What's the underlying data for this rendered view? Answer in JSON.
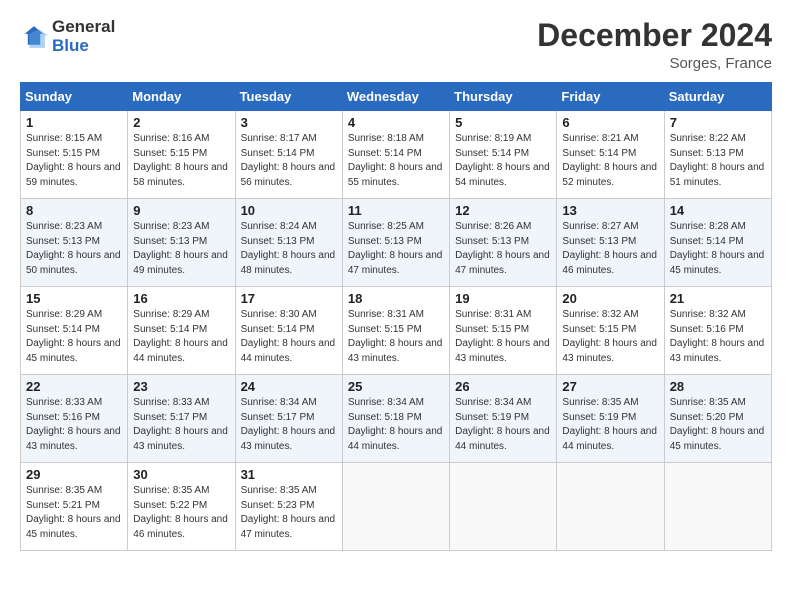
{
  "header": {
    "logo_line1": "General",
    "logo_line2": "Blue",
    "month": "December 2024",
    "location": "Sorges, France"
  },
  "days_of_week": [
    "Sunday",
    "Monday",
    "Tuesday",
    "Wednesday",
    "Thursday",
    "Friday",
    "Saturday"
  ],
  "weeks": [
    [
      {
        "day": "1",
        "sunrise": "8:15 AM",
        "sunset": "5:15 PM",
        "daylight": "8 hours and 59 minutes."
      },
      {
        "day": "2",
        "sunrise": "8:16 AM",
        "sunset": "5:15 PM",
        "daylight": "8 hours and 58 minutes."
      },
      {
        "day": "3",
        "sunrise": "8:17 AM",
        "sunset": "5:14 PM",
        "daylight": "8 hours and 56 minutes."
      },
      {
        "day": "4",
        "sunrise": "8:18 AM",
        "sunset": "5:14 PM",
        "daylight": "8 hours and 55 minutes."
      },
      {
        "day": "5",
        "sunrise": "8:19 AM",
        "sunset": "5:14 PM",
        "daylight": "8 hours and 54 minutes."
      },
      {
        "day": "6",
        "sunrise": "8:21 AM",
        "sunset": "5:14 PM",
        "daylight": "8 hours and 52 minutes."
      },
      {
        "day": "7",
        "sunrise": "8:22 AM",
        "sunset": "5:13 PM",
        "daylight": "8 hours and 51 minutes."
      }
    ],
    [
      {
        "day": "8",
        "sunrise": "8:23 AM",
        "sunset": "5:13 PM",
        "daylight": "8 hours and 50 minutes."
      },
      {
        "day": "9",
        "sunrise": "8:23 AM",
        "sunset": "5:13 PM",
        "daylight": "8 hours and 49 minutes."
      },
      {
        "day": "10",
        "sunrise": "8:24 AM",
        "sunset": "5:13 PM",
        "daylight": "8 hours and 48 minutes."
      },
      {
        "day": "11",
        "sunrise": "8:25 AM",
        "sunset": "5:13 PM",
        "daylight": "8 hours and 47 minutes."
      },
      {
        "day": "12",
        "sunrise": "8:26 AM",
        "sunset": "5:13 PM",
        "daylight": "8 hours and 47 minutes."
      },
      {
        "day": "13",
        "sunrise": "8:27 AM",
        "sunset": "5:13 PM",
        "daylight": "8 hours and 46 minutes."
      },
      {
        "day": "14",
        "sunrise": "8:28 AM",
        "sunset": "5:14 PM",
        "daylight": "8 hours and 45 minutes."
      }
    ],
    [
      {
        "day": "15",
        "sunrise": "8:29 AM",
        "sunset": "5:14 PM",
        "daylight": "8 hours and 45 minutes."
      },
      {
        "day": "16",
        "sunrise": "8:29 AM",
        "sunset": "5:14 PM",
        "daylight": "8 hours and 44 minutes."
      },
      {
        "day": "17",
        "sunrise": "8:30 AM",
        "sunset": "5:14 PM",
        "daylight": "8 hours and 44 minutes."
      },
      {
        "day": "18",
        "sunrise": "8:31 AM",
        "sunset": "5:15 PM",
        "daylight": "8 hours and 43 minutes."
      },
      {
        "day": "19",
        "sunrise": "8:31 AM",
        "sunset": "5:15 PM",
        "daylight": "8 hours and 43 minutes."
      },
      {
        "day": "20",
        "sunrise": "8:32 AM",
        "sunset": "5:15 PM",
        "daylight": "8 hours and 43 minutes."
      },
      {
        "day": "21",
        "sunrise": "8:32 AM",
        "sunset": "5:16 PM",
        "daylight": "8 hours and 43 minutes."
      }
    ],
    [
      {
        "day": "22",
        "sunrise": "8:33 AM",
        "sunset": "5:16 PM",
        "daylight": "8 hours and 43 minutes."
      },
      {
        "day": "23",
        "sunrise": "8:33 AM",
        "sunset": "5:17 PM",
        "daylight": "8 hours and 43 minutes."
      },
      {
        "day": "24",
        "sunrise": "8:34 AM",
        "sunset": "5:17 PM",
        "daylight": "8 hours and 43 minutes."
      },
      {
        "day": "25",
        "sunrise": "8:34 AM",
        "sunset": "5:18 PM",
        "daylight": "8 hours and 44 minutes."
      },
      {
        "day": "26",
        "sunrise": "8:34 AM",
        "sunset": "5:19 PM",
        "daylight": "8 hours and 44 minutes."
      },
      {
        "day": "27",
        "sunrise": "8:35 AM",
        "sunset": "5:19 PM",
        "daylight": "8 hours and 44 minutes."
      },
      {
        "day": "28",
        "sunrise": "8:35 AM",
        "sunset": "5:20 PM",
        "daylight": "8 hours and 45 minutes."
      }
    ],
    [
      {
        "day": "29",
        "sunrise": "8:35 AM",
        "sunset": "5:21 PM",
        "daylight": "8 hours and 45 minutes."
      },
      {
        "day": "30",
        "sunrise": "8:35 AM",
        "sunset": "5:22 PM",
        "daylight": "8 hours and 46 minutes."
      },
      {
        "day": "31",
        "sunrise": "8:35 AM",
        "sunset": "5:23 PM",
        "daylight": "8 hours and 47 minutes."
      },
      null,
      null,
      null,
      null
    ]
  ]
}
